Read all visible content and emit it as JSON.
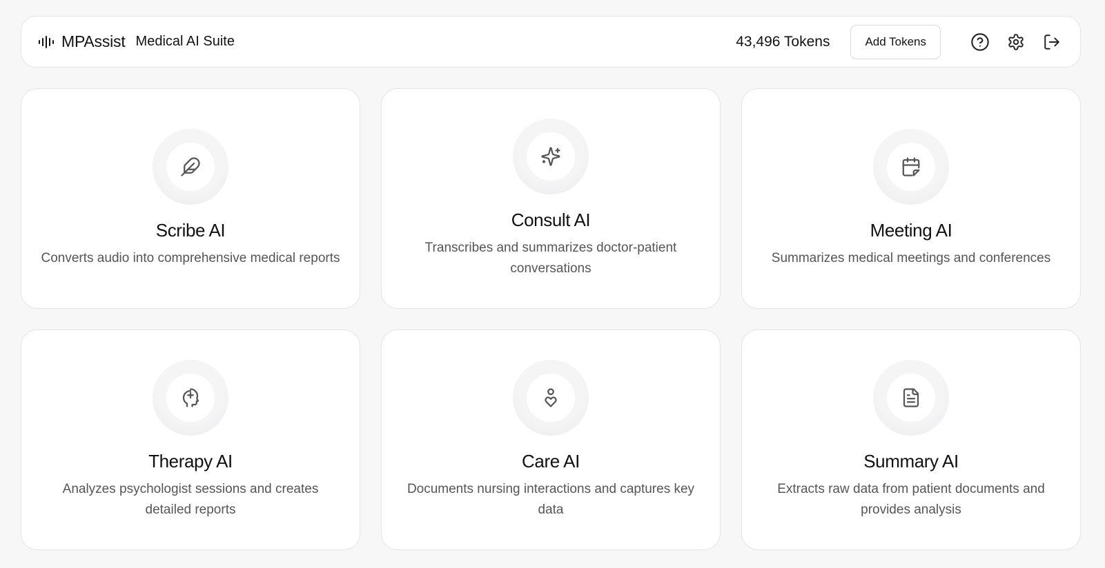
{
  "header": {
    "brand_name": "MPAssist",
    "brand_subtitle": "Medical AI Suite",
    "tokens": "43,496 Tokens",
    "add_tokens_label": "Add Tokens",
    "icons": [
      "audio-waveform-icon",
      "help-circle-icon",
      "gear-icon",
      "logout-icon"
    ]
  },
  "cards": [
    {
      "title": "Scribe AI",
      "description": "Converts audio into comprehensive medical reports",
      "icon": "feather-icon"
    },
    {
      "title": "Consult AI",
      "description": "Transcribes and summarizes doctor-patient conversations",
      "icon": "sparkles-icon"
    },
    {
      "title": "Meeting AI",
      "description": "Summarizes medical meetings and conferences",
      "icon": "calendar-icon"
    },
    {
      "title": "Therapy AI",
      "description": "Analyzes psychologist sessions and creates detailed reports",
      "icon": "brain-head-icon"
    },
    {
      "title": "Care AI",
      "description": "Documents nursing interactions and captures key data",
      "icon": "person-heart-icon"
    },
    {
      "title": "Summary AI",
      "description": "Extracts raw data from patient documents and provides analysis",
      "icon": "document-icon"
    }
  ],
  "colors": {
    "background": "#f7f7f7",
    "card": "#ffffff",
    "border": "#e4e4e7",
    "icon": "#555555"
  }
}
